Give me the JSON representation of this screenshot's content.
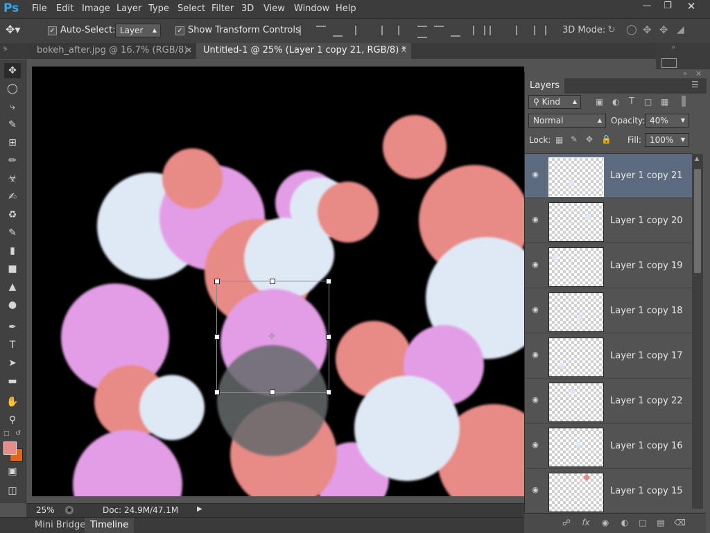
{
  "app": {
    "logo": "Ps"
  },
  "menu": [
    "File",
    "Edit",
    "Image",
    "Layer",
    "Type",
    "Select",
    "Filter",
    "3D",
    "View",
    "Window",
    "Help"
  ],
  "window_buttons": [
    "minimize",
    "restore",
    "close"
  ],
  "options": {
    "auto_select_label": "Auto-Select:",
    "auto_select_checked": true,
    "auto_select_value": "Layer",
    "show_transform_label": "Show Transform Controls",
    "show_transform_checked": true,
    "mode_3d_label": "3D Mode:"
  },
  "tabs": [
    {
      "label": "bokeh_after.jpg @ 16.7% (RGB/8)",
      "active": false
    },
    {
      "label": "Untitled-1 @ 25% (Layer 1 copy 21, RGB/8) *",
      "active": true
    }
  ],
  "canvas": {
    "background": "#000000",
    "colors": {
      "pink": "#e39de6",
      "coral": "#e88a86",
      "white": "#dfe9f6",
      "gray": "#666a6c"
    }
  },
  "status": {
    "zoom": "25%",
    "doc_size": "Doc: 24.9M/47.1M"
  },
  "bottom_tabs": [
    {
      "label": "Mini Bridge",
      "active": false
    },
    {
      "label": "Timeline",
      "active": true
    }
  ],
  "layers_panel": {
    "title": "Layers",
    "filter_kind": "Kind",
    "blend_mode": "Normal",
    "opacity_label": "Opacity:",
    "opacity_value": "40%",
    "lock_label": "Lock:",
    "fill_label": "Fill:",
    "fill_value": "100%",
    "layers": [
      {
        "name": "Layer 1 copy 21",
        "selected": true,
        "dot_color": "#dfe9f6"
      },
      {
        "name": "Layer 1 copy 20",
        "selected": false,
        "dot_color": "#dfe9f6"
      },
      {
        "name": "Layer 1 copy 19",
        "selected": false,
        "dot_color": "#dfe9f6"
      },
      {
        "name": "Layer 1 copy 18",
        "selected": false,
        "dot_color": "#dfe9f6"
      },
      {
        "name": "Layer 1 copy 17",
        "selected": false,
        "dot_color": "#dfe9f6"
      },
      {
        "name": "Layer 1 copy 22",
        "selected": false,
        "dot_color": "#dfe9f6"
      },
      {
        "name": "Layer 1 copy 16",
        "selected": false,
        "dot_color": "#dfe9f6"
      },
      {
        "name": "Layer 1 copy 15",
        "selected": false,
        "dot_color": "#e88a86"
      }
    ]
  },
  "colors": {
    "foreground": "#e88a86",
    "background": "#e0661c",
    "selected_layer": "#5d6b80"
  }
}
